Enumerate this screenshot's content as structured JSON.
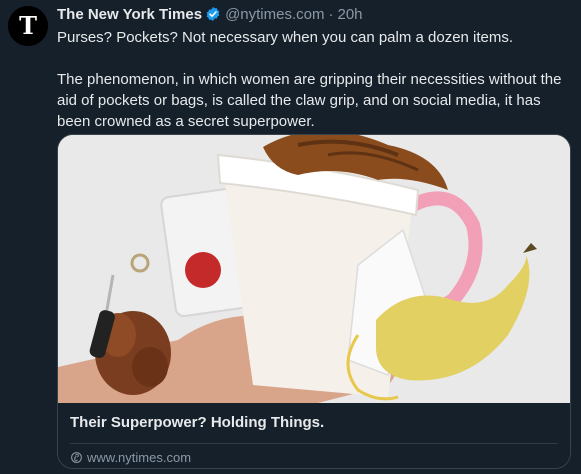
{
  "author": {
    "name": "The New York Times",
    "handle": "@nytimes.com",
    "separator": "·",
    "time": "20h",
    "avatar_icon": "nyt-logo-icon",
    "verified_icon": "verified-badge-icon",
    "verified_color": "#1d9bf0"
  },
  "tweet": {
    "line1": "Purses? Pockets? Not necessary when you can palm a dozen items.",
    "line2": "The phenomenon, in which women are gripping their necessities without the aid of pockets or bags, is called the claw grip, and on social media, it has been crowned as a secret superpower."
  },
  "card": {
    "title": "Their Superpower? Holding Things.",
    "domain": "www.nytimes.com",
    "domain_icon": "link-icon",
    "image_subject": "hand-holding-items-photo"
  },
  "colors": {
    "background": "#15202b",
    "text": "#e7e9ea",
    "muted": "#8b98a5",
    "border": "#38444d"
  }
}
